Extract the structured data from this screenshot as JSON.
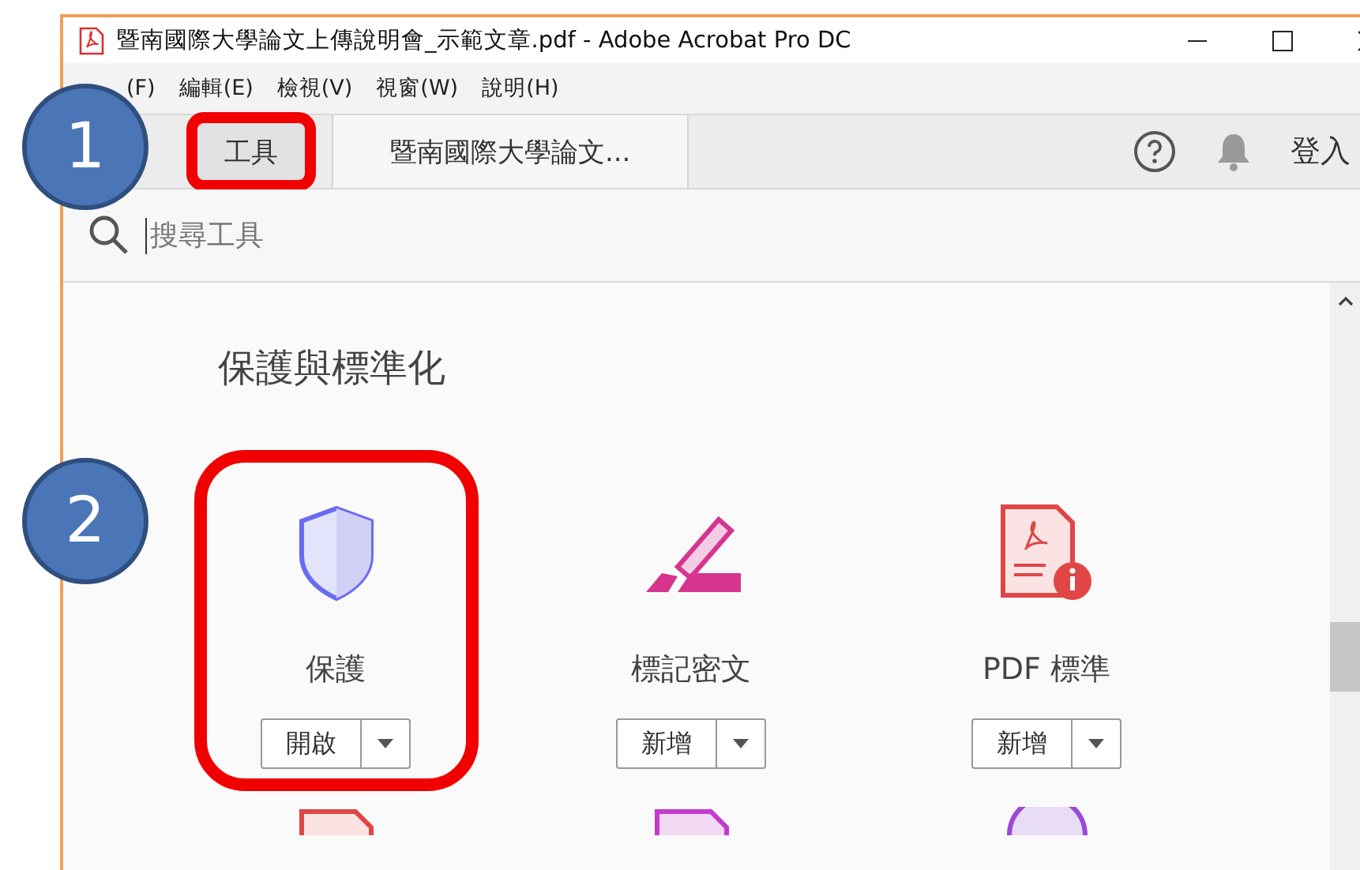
{
  "window": {
    "title": "暨南國際大學論文上傳說明會_示範文章.pdf - Adobe Acrobat Pro DC"
  },
  "menu": [
    "(F)",
    "編輯(E)",
    "檢視(V)",
    "視窗(W)",
    "說明(H)"
  ],
  "tabs": [
    {
      "label": "工具",
      "selected": true,
      "highlighted": true
    },
    {
      "label": "暨南國際大學論文...",
      "selected": false,
      "highlighted": false
    }
  ],
  "sign_in": "登入",
  "search": {
    "placeholder": "搜尋工具"
  },
  "section": {
    "title": "保護與標準化",
    "tools": [
      {
        "name": "保護",
        "button": "開啟",
        "highlighted": true
      },
      {
        "name": "標記密文",
        "button": "新增",
        "highlighted": false
      },
      {
        "name": "PDF 標準",
        "button": "新增",
        "highlighted": false
      }
    ]
  },
  "annotations": [
    {
      "label": "1"
    },
    {
      "label": "2"
    }
  ]
}
